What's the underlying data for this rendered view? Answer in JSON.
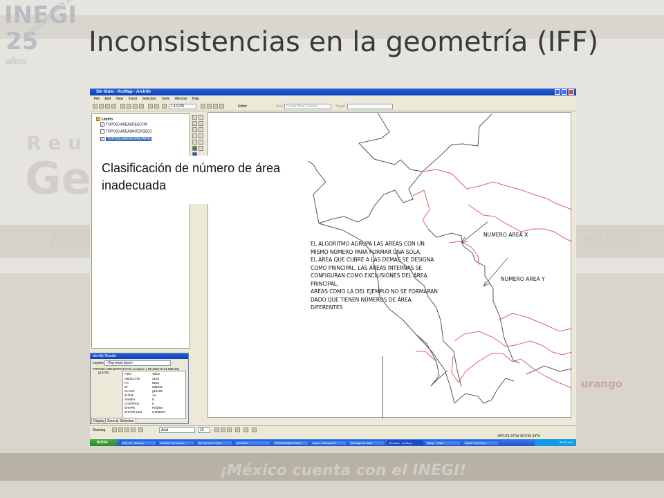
{
  "slide": {
    "title": "Inconsistencias en la geometría (IFF)",
    "logo": {
      "name": "INEGI",
      "number": "25",
      "years": "años",
      "tagline": "Informando a México"
    },
    "background_words": [
      "R e u",
      "Ge",
      "Fort",
      "xico!",
      "urango"
    ],
    "footer": "¡México cuenta con el INEGI!"
  },
  "window": {
    "title": "Sin título - ArcMap - ArcInfo",
    "menu": [
      "File",
      "Edit",
      "View",
      "Insert",
      "Selection",
      "Tools",
      "Window",
      "Help"
    ],
    "scale": "1:12,976",
    "editor_label": "Editor",
    "task_label": "Task:",
    "task_value": "Create New Feature",
    "target_label": "Target:"
  },
  "toc": {
    "root": "Layers",
    "layers": [
      {
        "name": "TOPO50.AREASDESCFIN",
        "checked": true,
        "highlighted": false
      },
      {
        "name": "TOPO50.AREASINTERSECC",
        "checked": false,
        "highlighted": false
      },
      {
        "name": "TOPO50.AREADIPALTAFIN",
        "checked": true,
        "highlighted": true
      }
    ]
  },
  "callout": "Clasificación de número de área inadecuada",
  "map": {
    "annotation_lines": [
      "EL ALGORITMO AGRUPA LAS AREAS CON UN",
      "MISMO NÚMERO PARA FORMAR UNA SOLA.",
      "EL ÁREA QUE CUBRE A LAS DEMAS SE DESIGNA",
      "COMO PRINCIPAL, LAS ÁREAS INTERNAS SE",
      "CONFIGURAN COMO EXCLUSIÓNES DEL ÁREA",
      "PRINCIPAL.",
      "AREAS COMO LA DEL EJEMPLO NO SE FORMARÁN",
      "DADO QUE TIENEN NÚMEROS DE ÁREA",
      "DIFERENTES"
    ],
    "label_x": "NUMERO AREA X",
    "label_y": "NUMERO AREA Y",
    "line_color": "#555555",
    "highlight_color": "#e06060"
  },
  "identify": {
    "title": "Identify Results",
    "layers_label": "Layers:",
    "layers_value": "<Top-most layer>",
    "feature": "TOPO50.AREADIPALTAFIN",
    "location": "Location: (-99.322176 24.055165)",
    "id": "g14c09",
    "header": [
      "Field",
      "Value"
    ],
    "rows": [
      [
        "OBJECTID",
        "2153"
      ],
      [
        "FC",
        "6120"
      ],
      [
        "ID",
        "935012"
      ],
      [
        "CLAVE",
        "g14c09"
      ],
      [
        "ZUTM",
        "14"
      ],
      [
        "NAREA",
        "6"
      ],
      [
        "CONTROL",
        "n"
      ],
      [
        "SHAPE",
        "Polyline"
      ],
      [
        "SHAPE.LEN",
        "0.009349"
      ]
    ]
  },
  "bottom_tabs": [
    "Display",
    "Source",
    "Selection"
  ],
  "drawing": {
    "label": "Drawing",
    "font": "Arial",
    "size": "10"
  },
  "status": {
    "coords": "-99°19'4.22\"W  24°3'20.34\"N"
  },
  "taskbar": {
    "start": "Inicio",
    "tasks": [
      "290, 09 - Winamp",
      "ArcSDE 9.0 Develo...",
      "ftp://10.23.4.37/20...",
      "inCmdFd",
      "PROBLEMAS CON E...",
      "Inbox - Microsoft O...",
      "Mensaje sin título",
      "Sin título - ArcMap -",
      "Dibujo - Paint",
      "Oracle SQL*Plus"
    ],
    "clock": "06:19 p.m."
  }
}
